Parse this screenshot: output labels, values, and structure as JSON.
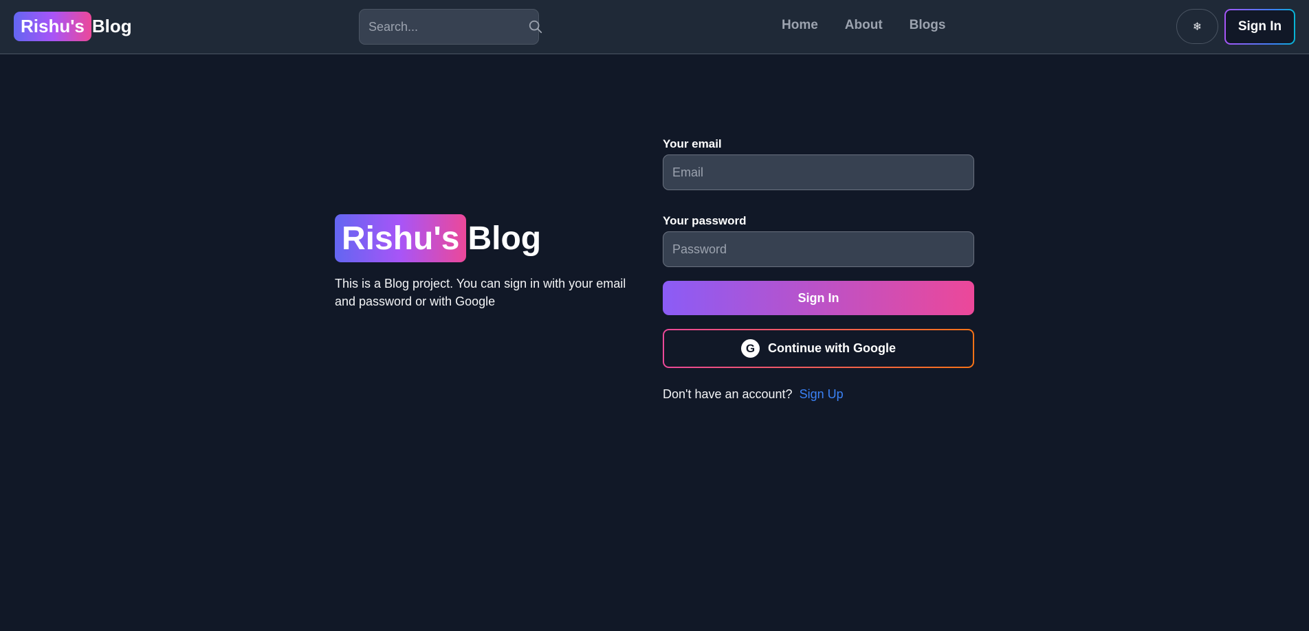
{
  "header": {
    "logo": {
      "badge": "Rishu's",
      "word": "Blog"
    },
    "search": {
      "placeholder": "Search..."
    },
    "nav": [
      {
        "label": "Home"
      },
      {
        "label": "About"
      },
      {
        "label": "Blogs"
      }
    ],
    "theme_toggle_icon": "❄",
    "sign_in_label": "Sign In"
  },
  "hero": {
    "logo": {
      "badge": "Rishu's",
      "word": "Blog"
    },
    "description": "This is a Blog project. You can sign in with your email and password or with Google"
  },
  "form": {
    "email_label": "Your email",
    "email_placeholder": "Email",
    "password_label": "Your password",
    "password_placeholder": "Password",
    "submit_label": "Sign In",
    "google_label": "Continue with Google",
    "google_icon_letter": "G",
    "signup_prompt": "Don't have an account?",
    "signup_link": "Sign Up"
  },
  "colors": {
    "background": "#111827",
    "navbar": "#1f2937",
    "gradient_start": "#6366f1",
    "gradient_mid": "#a855f7",
    "gradient_end": "#ec4899",
    "link": "#3b82f6"
  },
  "icons": {
    "search": "search-icon",
    "theme": "snowflake-icon",
    "google": "google-icon"
  }
}
